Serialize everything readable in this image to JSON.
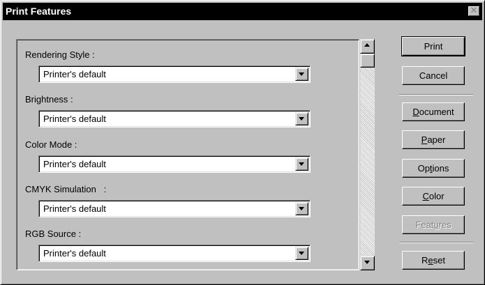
{
  "window": {
    "title": "Print Features",
    "close_glyph": "✕"
  },
  "fields": [
    {
      "label": "Rendering Style :",
      "value": "Printer's default"
    },
    {
      "label": "Brightness :",
      "value": "Printer's default"
    },
    {
      "label": "Color Mode :",
      "value": "Printer's default"
    },
    {
      "label": "CMYK Simulation   :",
      "value": "Printer's default"
    },
    {
      "label": "RGB Source :",
      "value": "Printer's default"
    }
  ],
  "buttons": {
    "print": {
      "label": "Print",
      "default": true
    },
    "cancel": {
      "label": "Cancel"
    },
    "document": {
      "label": "Document",
      "mnemonic": "D"
    },
    "paper": {
      "label": "Paper",
      "mnemonic": "P"
    },
    "options": {
      "label": "Options",
      "mnemonic": "t"
    },
    "color": {
      "label": "Color",
      "mnemonic": "C"
    },
    "features": {
      "label": "Features",
      "mnemonic": "u",
      "disabled": true
    },
    "reset": {
      "label": "Reset",
      "mnemonic": "e"
    }
  },
  "scrollbar": {
    "up_icon": "scroll-up-arrow",
    "down_icon": "scroll-down-arrow",
    "position": 0
  },
  "colors": {
    "face": "#c0c0c0",
    "titlebar": "#000000",
    "field_bg": "#ffffff",
    "disabled_text": "#808080"
  }
}
